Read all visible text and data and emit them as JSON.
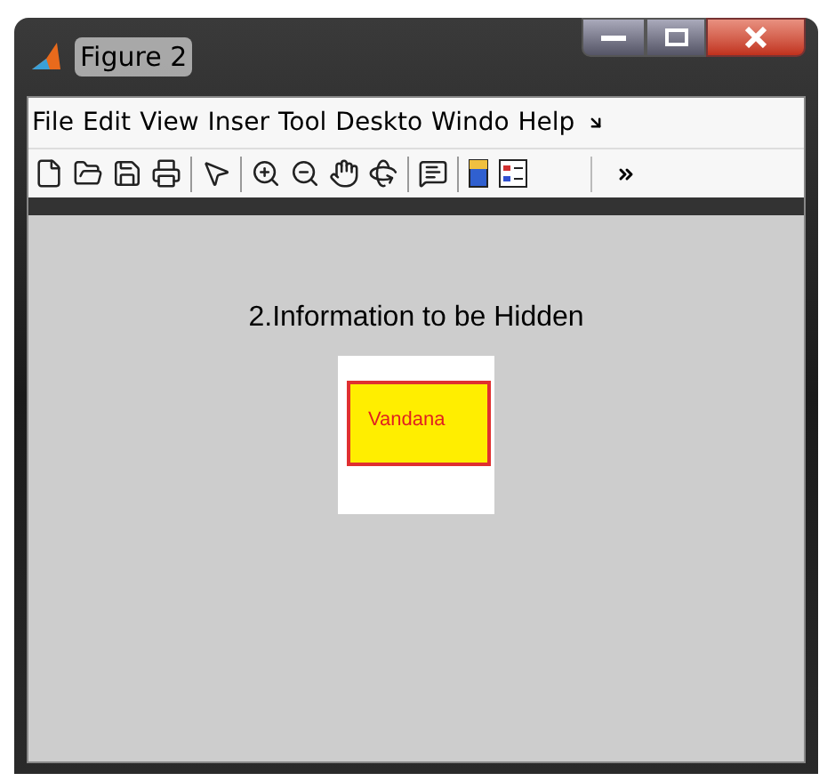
{
  "window": {
    "title": "Figure 2"
  },
  "menu": [
    "File",
    "Edit",
    "View",
    "Inser",
    "Tool",
    "Deskto",
    "Windo",
    "Help"
  ],
  "figure": {
    "title": "2.Information to be Hidden",
    "label": "Vandana"
  }
}
